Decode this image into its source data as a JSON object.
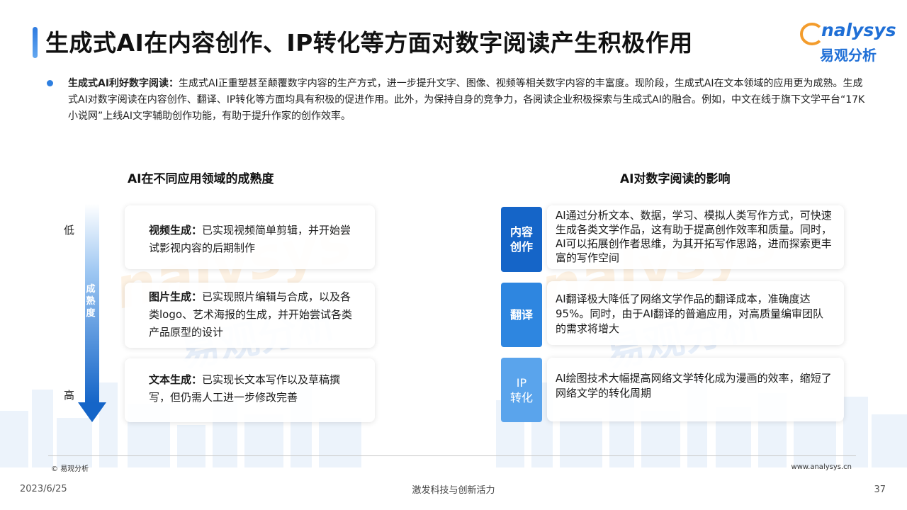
{
  "header": {
    "title": "生成式AI在内容创作、IP转化等方面对数字阅读产生积极作用",
    "logo_en": "nalysys",
    "logo_cn": "易观分析"
  },
  "intro": {
    "lead": "生成式AI利好数字阅读：",
    "text": "生成式AI正重塑甚至颠覆数字内容的生产方式，进一步提升文字、图像、视频等相关数字内容的丰富度。现阶段，生成式AI在文本领域的应用更为成熟。生成式AI对数字阅读在内容创作、翻译、IP转化等方面均具有积极的促进作用。此外，为保持自身的竞争力，各阅读企业积极探索与生成式AI的融合。例如，中文在线于旗下文学平台“17K小说网”上线AI文字辅助创作功能，有助于提升作家的创作效率。"
  },
  "left": {
    "title": "AI在不同应用领域的成熟度",
    "axis_low": "低",
    "axis_high": "高",
    "axis_label": "成熟度",
    "items": [
      {
        "lead": "视频生成：",
        "text": "已实现视频简单剪辑，并开始尝试影视内容的后期制作"
      },
      {
        "lead": "图片生成：",
        "text": "已实现照片编辑与合成，以及各类logo、艺术海报的生成，并开始尝试各类产品原型的设计"
      },
      {
        "lead": "文本生成：",
        "text": "已实现长文本写作以及草稿撰写，但仍需人工进一步修改完善"
      }
    ]
  },
  "right": {
    "title": "AI对数字阅读的影响",
    "items": [
      {
        "tag": "内容\n创作",
        "color": "#1565c8",
        "text": "AI通过分析文本、数据，学习、模拟人类写作方式，可快速生成各类文学作品，这有助于提高创作效率和质量。同时，AI可以拓展创作者思维，为其开拓写作思路，进而探索更丰富的写作空间"
      },
      {
        "tag": "翻译",
        "color": "#2e86e0",
        "text": "AI翻译极大降低了网络文学作品的翻译成本，准确度达95%。同时，由于AI翻译的普遍应用，对高质量编审团队的需求将增大"
      },
      {
        "tag": "IP\n转化",
        "color": "#5aa4ec",
        "text": "AI绘图技术大幅提高网络文学转化成为漫画的效率，缩短了网络文学的转化周期"
      }
    ]
  },
  "footer": {
    "copyright": "© 易观分析",
    "url": "www.analysys.cn",
    "date": "2023/6/25",
    "slogan": "激发科技与创新活力",
    "page": "37"
  },
  "colors": {
    "accent": "#1f6fd6",
    "logo_orange": "#f39c2c"
  }
}
